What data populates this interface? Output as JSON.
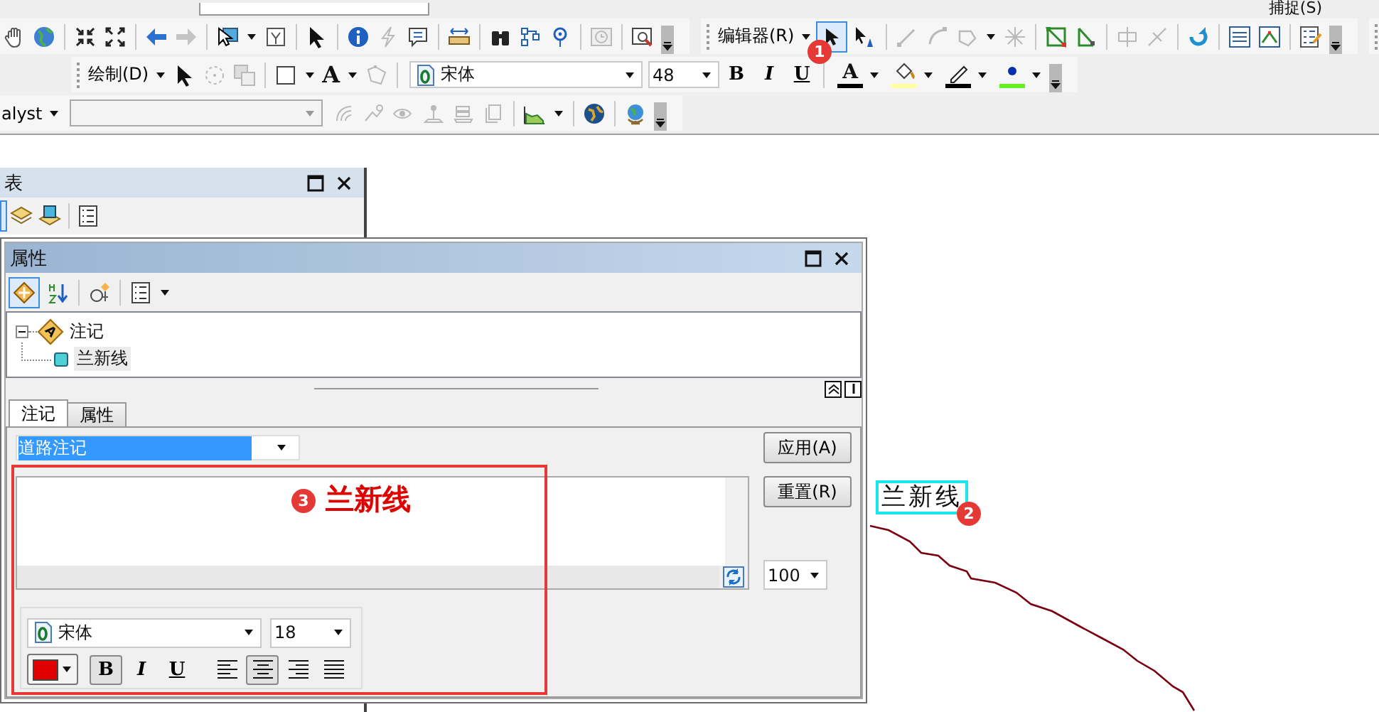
{
  "snap_menu": "捕捉(S)",
  "editor_toolbar": {
    "menu": "编辑器(R)",
    "tools": [
      {
        "selected": true
      },
      {
        "selected": false
      }
    ]
  },
  "draw_toolbar": {
    "menu": "绘制(D)",
    "text_tool": "A",
    "font": "宋体",
    "size": "48",
    "styles": [
      {
        "label": "B",
        "selected": false
      },
      {
        "label": "I",
        "selected": false
      },
      {
        "label": "U",
        "selected": false
      }
    ],
    "font_color_glyph": "A"
  },
  "analyst_toolbar": {
    "menu": "alyst"
  },
  "toc": {
    "title": "表"
  },
  "properties": {
    "title": "属性",
    "view_buttons": [
      {
        "selected": true
      },
      {
        "selected": false
      }
    ],
    "tree": [
      {
        "label": "注记",
        "glyph": "A",
        "expanded": true,
        "children": [
          {
            "label": "兰新线",
            "selected": true
          }
        ]
      }
    ],
    "tabs": [
      {
        "label": "注记",
        "selected": true
      },
      {
        "label": "属性",
        "selected": false
      }
    ],
    "class_combo": {
      "value": "道路注记",
      "selected": true
    },
    "buttons": [
      "应用(A)",
      "重置(R)"
    ],
    "preview_text": "兰新线",
    "zoom": "100",
    "font": "宋体",
    "size": "18",
    "styles": [
      {
        "label": "B",
        "selected": true
      },
      {
        "label": "I",
        "selected": false
      },
      {
        "label": "U",
        "selected": false
      }
    ],
    "alignment": [
      {
        "kind": "left",
        "selected": false
      },
      {
        "kind": "center",
        "selected": true
      },
      {
        "kind": "right",
        "selected": false
      },
      {
        "kind": "justify",
        "selected": false
      }
    ]
  },
  "map": {
    "label": "兰新线",
    "selected": true
  },
  "badges": [
    "1",
    "2",
    "3"
  ]
}
